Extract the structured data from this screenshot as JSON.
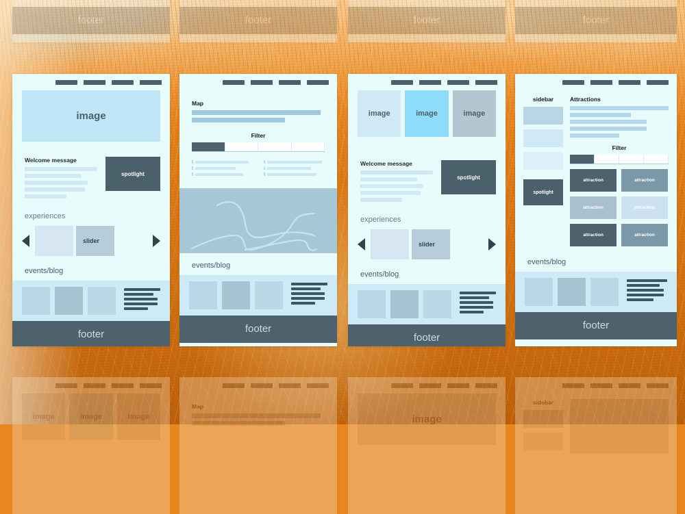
{
  "palette": {
    "card_bg": "#e9fcfc",
    "nav_pill": "#4a606b",
    "hero_blue": "#bfe6f7",
    "footer_bg": "#4d626c",
    "footer_text": "#cfdce1",
    "blog_strip": "#cdeaf7",
    "spotlight_bg": "#4a606b",
    "map_bg": "#a5c7d6",
    "map_line": "#bfe6f7",
    "active_tab": "#4d626c",
    "background_orange": "#e8871f"
  },
  "nav": {
    "item_count": 4
  },
  "cards": [
    {
      "id": "card-home",
      "hero_label": "image",
      "welcome_title": "Welcome message",
      "welcome_line_widths": [
        100,
        78,
        87,
        83,
        58
      ],
      "spotlight_label": "spotlight",
      "experiences_label": "experiences",
      "slider_label": "slider",
      "slide_colors": [
        "#d7e7f2",
        "#b8cddb"
      ],
      "events_label": "events/blog",
      "blog_thumb_colors": [
        "#b9d6e6",
        "#a7c3d2",
        "#bcd8e7"
      ],
      "blog_line_widths": [
        100,
        82,
        92,
        92,
        66
      ],
      "footer_label": "footer"
    },
    {
      "id": "card-map",
      "map_title": "Map",
      "map_line_widths": [
        97,
        70
      ],
      "filter_title": "Filter",
      "tabs": [
        {
          "label": "",
          "active": true
        },
        {
          "label": "",
          "active": false
        },
        {
          "label": "",
          "active": false
        },
        {
          "label": "",
          "active": false
        }
      ],
      "list_left_widths": [
        88,
        66,
        79
      ],
      "list_right_widths": [
        90,
        72,
        81
      ],
      "events_label": "events/blog",
      "blog_thumb_colors": [
        "#b9d6e6",
        "#a7c3d2",
        "#bcd8e7"
      ],
      "blog_line_widths": [
        100,
        82,
        92,
        92,
        66
      ],
      "footer_label": "footer"
    },
    {
      "id": "card-gallery",
      "images": [
        {
          "label": "image",
          "color": "#cfe9f7"
        },
        {
          "label": "image",
          "color": "#8fdcfa"
        },
        {
          "label": "image",
          "color": "#b3c7d1"
        }
      ],
      "welcome_title": "Welcome message",
      "welcome_line_widths": [
        100,
        78,
        87,
        83,
        58
      ],
      "spotlight_label": "spotlight",
      "experiences_label": "experiences",
      "slider_label": "slider",
      "slide_colors": [
        "#d7e7f2",
        "#b8cddb"
      ],
      "events_label": "events/blog",
      "blog_thumb_colors": [
        "#b9d6e6",
        "#a7c3d2",
        "#bcd8e7"
      ],
      "blog_line_widths": [
        100,
        82,
        92,
        92,
        66
      ],
      "footer_label": "footer"
    },
    {
      "id": "card-attractions",
      "sidebar_label": "sidebar",
      "sidebar_block_colors": [
        "#b8d6e6",
        "#cfe9f7",
        "#dcf0fa"
      ],
      "spotlight_label": "spotlight",
      "attractions_title": "Attractions",
      "attractions_line_widths": [
        100,
        62,
        78,
        78,
        50
      ],
      "filter_title": "Filter",
      "tabs": [
        {
          "label": "",
          "active": true
        },
        {
          "label": "",
          "active": false
        },
        {
          "label": "",
          "active": false
        },
        {
          "label": "",
          "active": false
        }
      ],
      "tiles": [
        {
          "label": "attraction",
          "color": "#4d626c"
        },
        {
          "label": "attraction",
          "color": "#7b98a8"
        },
        {
          "label": "attraction",
          "color": "#a9c0ce"
        },
        {
          "label": "attraction",
          "color": "#cde2f1"
        },
        {
          "label": "attraction",
          "color": "#4d626c"
        },
        {
          "label": "attraction",
          "color": "#7b98a8"
        }
      ],
      "events_label": "events/blog",
      "blog_thumb_colors": [
        "#b9d6e6",
        "#a7c3d2",
        "#bcd8e7"
      ],
      "blog_line_widths": [
        100,
        82,
        92,
        92,
        66
      ],
      "footer_label": "footer"
    }
  ],
  "ghost_top": [
    {
      "id": "ghost-top-1",
      "footer_label": "footer"
    },
    {
      "id": "ghost-top-2",
      "footer_label": "footer"
    },
    {
      "id": "ghost-top-3",
      "footer_label": "footer"
    },
    {
      "id": "ghost-top-4",
      "footer_label": "footer"
    }
  ],
  "ghost_bottom": [
    {
      "id": "ghost-bottom-gallery",
      "images": [
        {
          "label": "image"
        },
        {
          "label": "image"
        },
        {
          "label": "image"
        }
      ]
    },
    {
      "id": "ghost-bottom-map",
      "map_title": "Map"
    },
    {
      "id": "ghost-bottom-hero",
      "hero_label": "image"
    },
    {
      "id": "ghost-bottom-sidebar",
      "sidebar_label": "sidebar"
    }
  ]
}
